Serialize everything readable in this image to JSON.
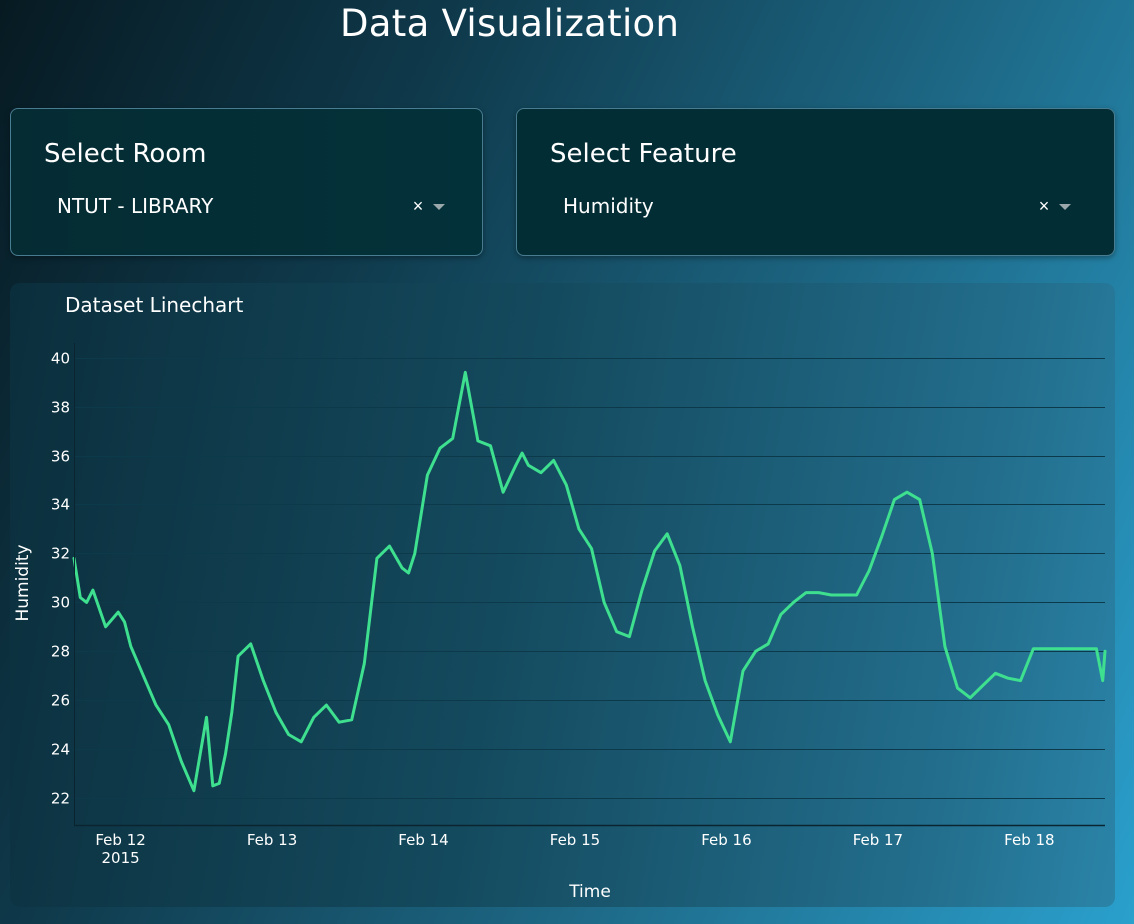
{
  "header": {
    "title": "Data Visualization"
  },
  "room_panel": {
    "label": "Select Room",
    "selected": "NTUT - LIBRARY",
    "clear": "×"
  },
  "feature_panel": {
    "label": "Select Feature",
    "selected": "Humidity",
    "clear": "×"
  },
  "colors": {
    "line": "#3ee08f",
    "gridline": "#0d3a4a",
    "axis": "#0a2430"
  },
  "chart_data": {
    "type": "line",
    "title": "Dataset Linechart",
    "xlabel": "Time",
    "ylabel": "Humidity",
    "ylim": [
      20.9,
      40.6
    ],
    "yticks": [
      22,
      24,
      26,
      28,
      30,
      32,
      34,
      36,
      38,
      40
    ],
    "xlim": [
      "2015-02-11T16:37",
      "2015-02-18T11:59"
    ],
    "xticks": [
      {
        "at": "2015-02-12",
        "label": "Feb 12",
        "sublabel": "2015"
      },
      {
        "at": "2015-02-13",
        "label": "Feb 13"
      },
      {
        "at": "2015-02-14",
        "label": "Feb 14"
      },
      {
        "at": "2015-02-15",
        "label": "Feb 15"
      },
      {
        "at": "2015-02-16",
        "label": "Feb 16"
      },
      {
        "at": "2015-02-17",
        "label": "Feb 17"
      },
      {
        "at": "2015-02-18",
        "label": "Feb 18"
      }
    ],
    "grid": true,
    "series": [
      {
        "x": [
          "2015-02-11T16:37",
          "2015-02-11T17:37",
          "2015-02-11T18:37",
          "2015-02-11T19:37",
          "2015-02-11T21:37",
          "2015-02-11T23:37",
          "2015-02-12T00:37",
          "2015-02-12T01:37",
          "2015-02-12T03:37",
          "2015-02-12T05:37",
          "2015-02-12T07:37",
          "2015-02-12T09:37",
          "2015-02-12T11:37",
          "2015-02-12T13:37",
          "2015-02-12T14:37",
          "2015-02-12T15:37",
          "2015-02-12T16:37",
          "2015-02-12T17:37",
          "2015-02-12T18:37",
          "2015-02-12T20:37",
          "2015-02-12T22:37",
          "2015-02-13T00:37",
          "2015-02-13T02:37",
          "2015-02-13T04:37",
          "2015-02-13T06:37",
          "2015-02-13T08:37",
          "2015-02-13T10:37",
          "2015-02-13T12:37",
          "2015-02-13T14:37",
          "2015-02-13T16:37",
          "2015-02-13T18:37",
          "2015-02-13T20:37",
          "2015-02-13T21:37",
          "2015-02-13T22:37",
          "2015-02-14T00:37",
          "2015-02-14T02:37",
          "2015-02-14T04:37",
          "2015-02-14T06:37",
          "2015-02-14T08:37",
          "2015-02-14T10:37",
          "2015-02-14T12:37",
          "2015-02-14T14:37",
          "2015-02-14T15:37",
          "2015-02-14T16:37",
          "2015-02-14T18:37",
          "2015-02-14T20:37",
          "2015-02-14T22:37",
          "2015-02-15T00:37",
          "2015-02-15T02:37",
          "2015-02-15T04:37",
          "2015-02-15T06:37",
          "2015-02-15T08:37",
          "2015-02-15T10:37",
          "2015-02-15T12:37",
          "2015-02-15T14:37",
          "2015-02-15T16:37",
          "2015-02-15T18:37",
          "2015-02-15T20:37",
          "2015-02-15T22:37",
          "2015-02-16T00:37",
          "2015-02-16T02:37",
          "2015-02-16T04:37",
          "2015-02-16T06:37",
          "2015-02-16T08:37",
          "2015-02-16T10:37",
          "2015-02-16T12:37",
          "2015-02-16T14:37",
          "2015-02-16T16:37",
          "2015-02-16T18:37",
          "2015-02-16T20:37",
          "2015-02-16T22:37",
          "2015-02-17T00:37",
          "2015-02-17T02:37",
          "2015-02-17T04:37",
          "2015-02-17T06:37",
          "2015-02-17T08:37",
          "2015-02-17T10:37",
          "2015-02-17T12:37",
          "2015-02-17T14:37",
          "2015-02-17T16:37",
          "2015-02-17T18:37",
          "2015-02-17T20:37",
          "2015-02-17T22:37",
          "2015-02-18T00:37",
          "2015-02-18T02:37",
          "2015-02-18T04:37",
          "2015-02-18T06:37",
          "2015-02-18T08:37",
          "2015-02-18T10:37",
          "2015-02-18T11:37",
          "2015-02-18T11:59"
        ],
        "y": [
          31.8,
          30.2,
          30.0,
          30.5,
          29.0,
          29.6,
          29.2,
          28.2,
          27.0,
          25.8,
          25.0,
          23.5,
          22.3,
          25.3,
          22.5,
          22.6,
          23.8,
          25.5,
          27.8,
          28.3,
          26.8,
          25.5,
          24.6,
          24.3,
          25.3,
          25.8,
          25.1,
          25.2,
          27.5,
          31.8,
          32.3,
          31.4,
          31.2,
          32.0,
          35.2,
          36.3,
          36.7,
          39.4,
          36.6,
          36.4,
          34.5,
          35.6,
          36.1,
          35.6,
          35.3,
          35.8,
          34.8,
          33.0,
          32.2,
          30.0,
          28.8,
          28.6,
          30.5,
          32.1,
          32.8,
          31.5,
          29.0,
          26.8,
          25.4,
          24.3,
          27.2,
          28.0,
          28.3,
          29.5,
          30.0,
          30.4,
          30.4,
          30.3,
          30.3,
          30.3,
          31.3,
          32.7,
          34.2,
          34.5,
          34.2,
          32.0,
          28.2,
          26.5,
          26.1,
          26.6,
          27.1,
          26.9,
          26.8,
          28.1,
          28.1,
          28.1,
          28.1,
          28.1,
          28.1,
          26.8,
          28.0
        ]
      }
    ]
  }
}
